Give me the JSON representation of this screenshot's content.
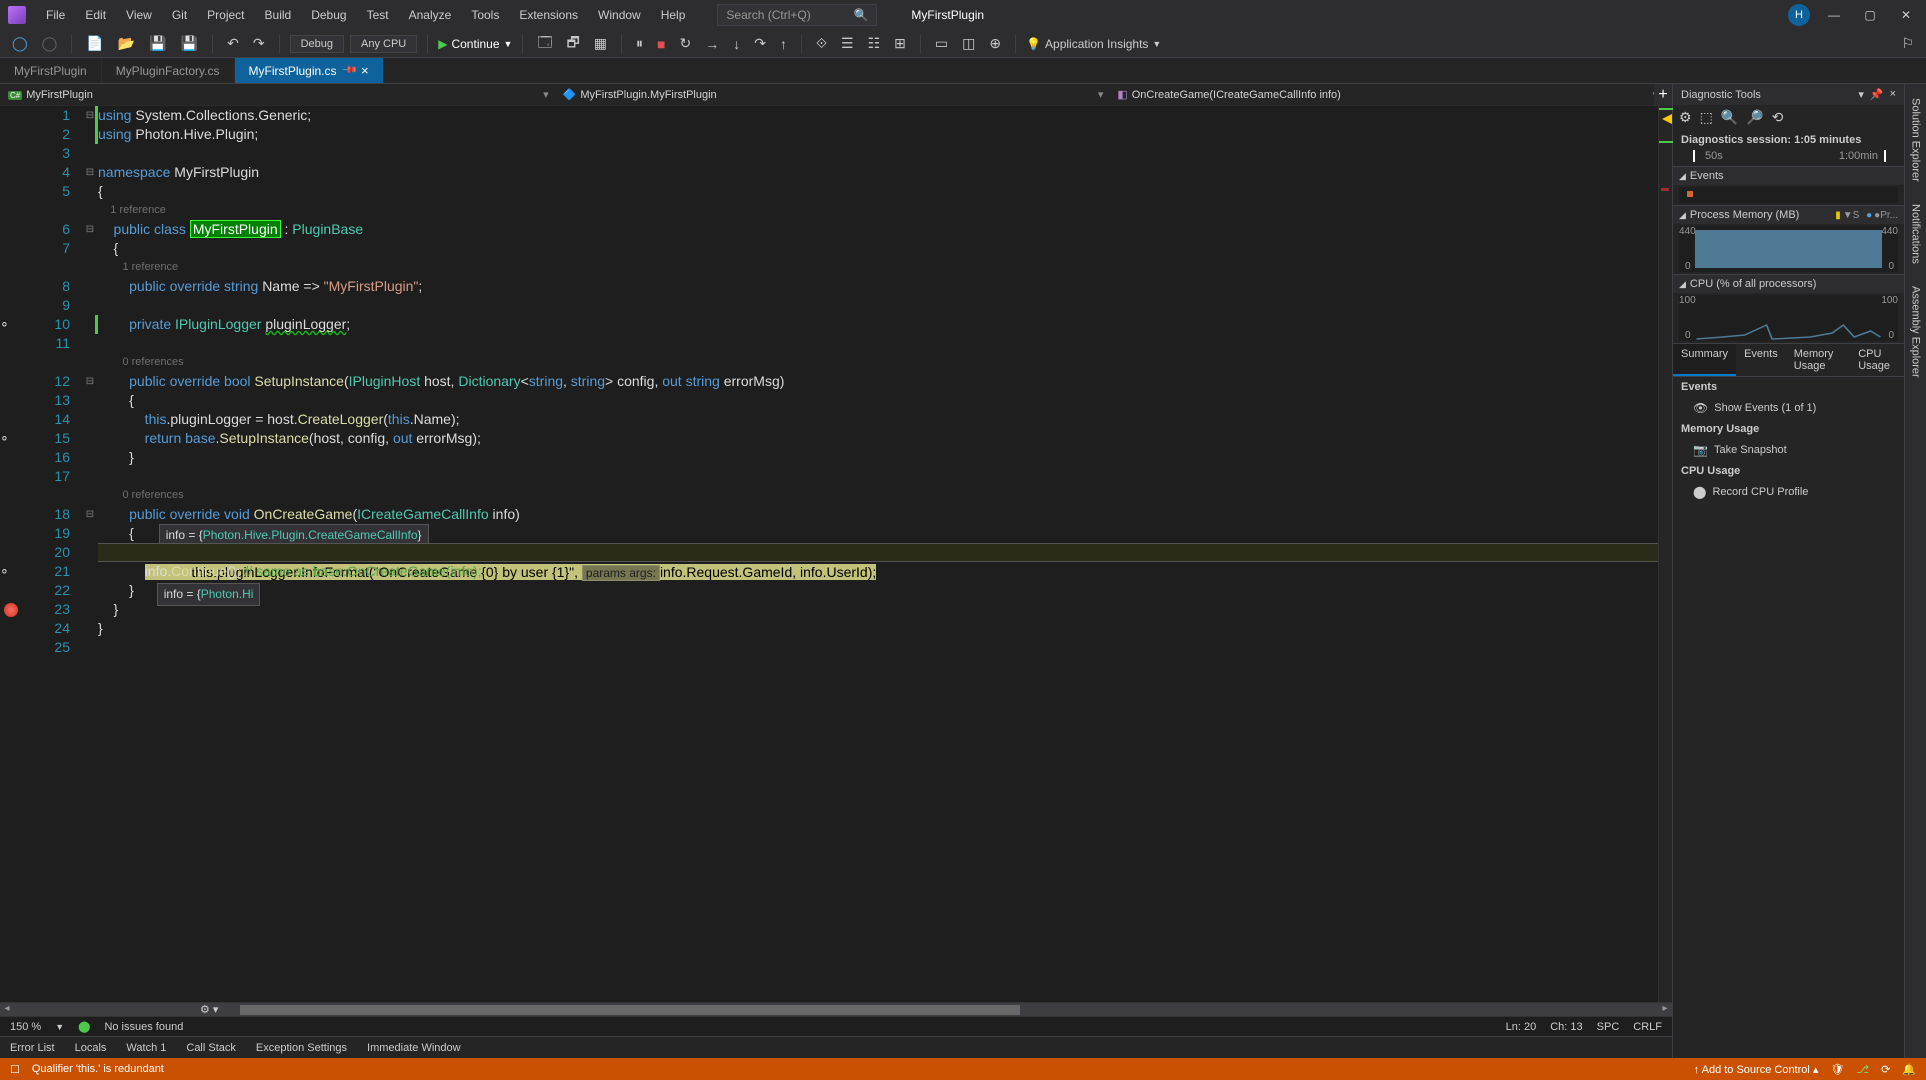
{
  "titlebar": {
    "menus": [
      "File",
      "Edit",
      "View",
      "Git",
      "Project",
      "Build",
      "Debug",
      "Test",
      "Analyze",
      "Tools",
      "Extensions",
      "Window",
      "Help"
    ],
    "search_placeholder": "Search (Ctrl+Q)",
    "solution_name": "MyFirstPlugin",
    "user_initial": "H"
  },
  "toolbar": {
    "config": "Debug",
    "platform": "Any CPU",
    "continue_label": "Continue",
    "app_insights": "Application Insights"
  },
  "doc_tabs": [
    {
      "label": "MyFirstPlugin",
      "active": false
    },
    {
      "label": "MyPluginFactory.cs",
      "active": false
    },
    {
      "label": "MyFirstPlugin.cs",
      "active": true,
      "pinned": true
    }
  ],
  "navbar": {
    "project": "MyFirstPlugin",
    "class": "MyFirstPlugin.MyFirstPlugin",
    "member": "OnCreateGame(ICreateGameCallInfo info)"
  },
  "codelens": {
    "class": "1 reference",
    "name_prop": "1 reference",
    "setup": "0 references",
    "oncreate": "0 references"
  },
  "code": {
    "l1a": "using",
    "l1b": " System.Collections.Generic;",
    "l2a": "using",
    "l2b": " Photon.Hive.Plugin;",
    "l4a": "namespace",
    "l4b": " MyFirstPlugin",
    "l5": "{",
    "l6a": "    public class ",
    "l6hl": "MyFirstPlugin",
    "l6b": " : ",
    "l6c": "PluginBase",
    "l7": "    {",
    "l8a": "        public override string ",
    "l8b": "Name ",
    "l8c": "=> ",
    "l8d": "\"MyFirstPlugin\"",
    "l8e": ";",
    "l10a": "        private ",
    "l10b": "IPluginLogger ",
    "l10c": "pluginLogger",
    "l10d": ";",
    "l12a": "        public override bool ",
    "l12b": "SetupInstance",
    "l12c": "(",
    "l12d": "IPluginHost ",
    "l12e": "host, ",
    "l12f": "Dictionary",
    "l12g": "<",
    "l12h": "string",
    "l12i": ", ",
    "l12j": "string",
    "l12k": "> config, ",
    "l12l": "out string ",
    "l12m": "errorMsg)",
    "l13": "        {",
    "l14a": "            this",
    "l14b": ".pluginLogger = host.",
    "l14c": "CreateLogger",
    "l14d": "(",
    "l14e": "this",
    "l14f": ".Name);",
    "l15a": "            return base",
    "l15b": ".",
    "l15c": "SetupInstance",
    "l15d": "(host, config, ",
    "l15e": "out",
    "l15f": " errorMsg);",
    "l16": "        }",
    "l18a": "        public override void ",
    "l18b": "OnCreateGame",
    "l18c": "(",
    "l18d": "ICreateGameCallInfo ",
    "l18e": "info)",
    "l19": "        {",
    "l20a": "            this",
    "l20b": ".pluginLogger.",
    "l20c": "InfoFormat",
    "l20d": "(",
    "l20e": "\"OnCreateGame {0} by user {1}\"",
    "l20f": ", ",
    "l20hint": "params args:",
    "l20g": "info.Request.GameId, info.UserId);",
    "l21a": "            info.",
    "l21b": "Continue",
    "l21c": "(); ",
    "l21d": "// same as base.OnCreateGame(info);",
    "l22": "        }",
    "l23": "    }",
    "l24": "}",
    "tip18a": "info = {",
    "tip18b": "Photon.Hive.Plugin.CreateGameCallInfo",
    "tip18c": "}",
    "tip20a": "info = {",
    "tip20b": "Photon.Hi"
  },
  "editor_status": {
    "zoom": "150 %",
    "issues": "No issues found",
    "ln": "Ln: 20",
    "ch": "Ch: 13",
    "spc": "SPC",
    "crlf": "CRLF"
  },
  "diag": {
    "title": "Diagnostic Tools",
    "session": "Diagnostics session: 1:05 minutes",
    "ruler_start": "50s",
    "ruler_end": "1:00min",
    "events_label": "Events",
    "mem_label": "Process Memory (MB)",
    "mem_max": "440",
    "mem_min": "0",
    "mem_legend1": "▼S",
    "mem_legend2": "●Pr...",
    "cpu_label": "CPU (% of all processors)",
    "cpu_max": "100",
    "cpu_min": "0",
    "tabs": [
      "Summary",
      "Events",
      "Memory Usage",
      "CPU Usage"
    ],
    "events_head": "Events",
    "show_events": "Show Events (1 of 1)",
    "mem_head": "Memory Usage",
    "snapshot": "Take Snapshot",
    "cpu_head": "CPU Usage",
    "record": "Record CPU Profile"
  },
  "right_tabs": [
    "Solution Explorer",
    "Notifications",
    "Assembly Explorer"
  ],
  "bottom_tabs": [
    "Error List",
    "Locals",
    "Watch 1",
    "Call Stack",
    "Exception Settings",
    "Immediate Window"
  ],
  "statusbar": {
    "msg": "Qualifier 'this.' is redundant",
    "source_control": "Add to Source Control"
  }
}
